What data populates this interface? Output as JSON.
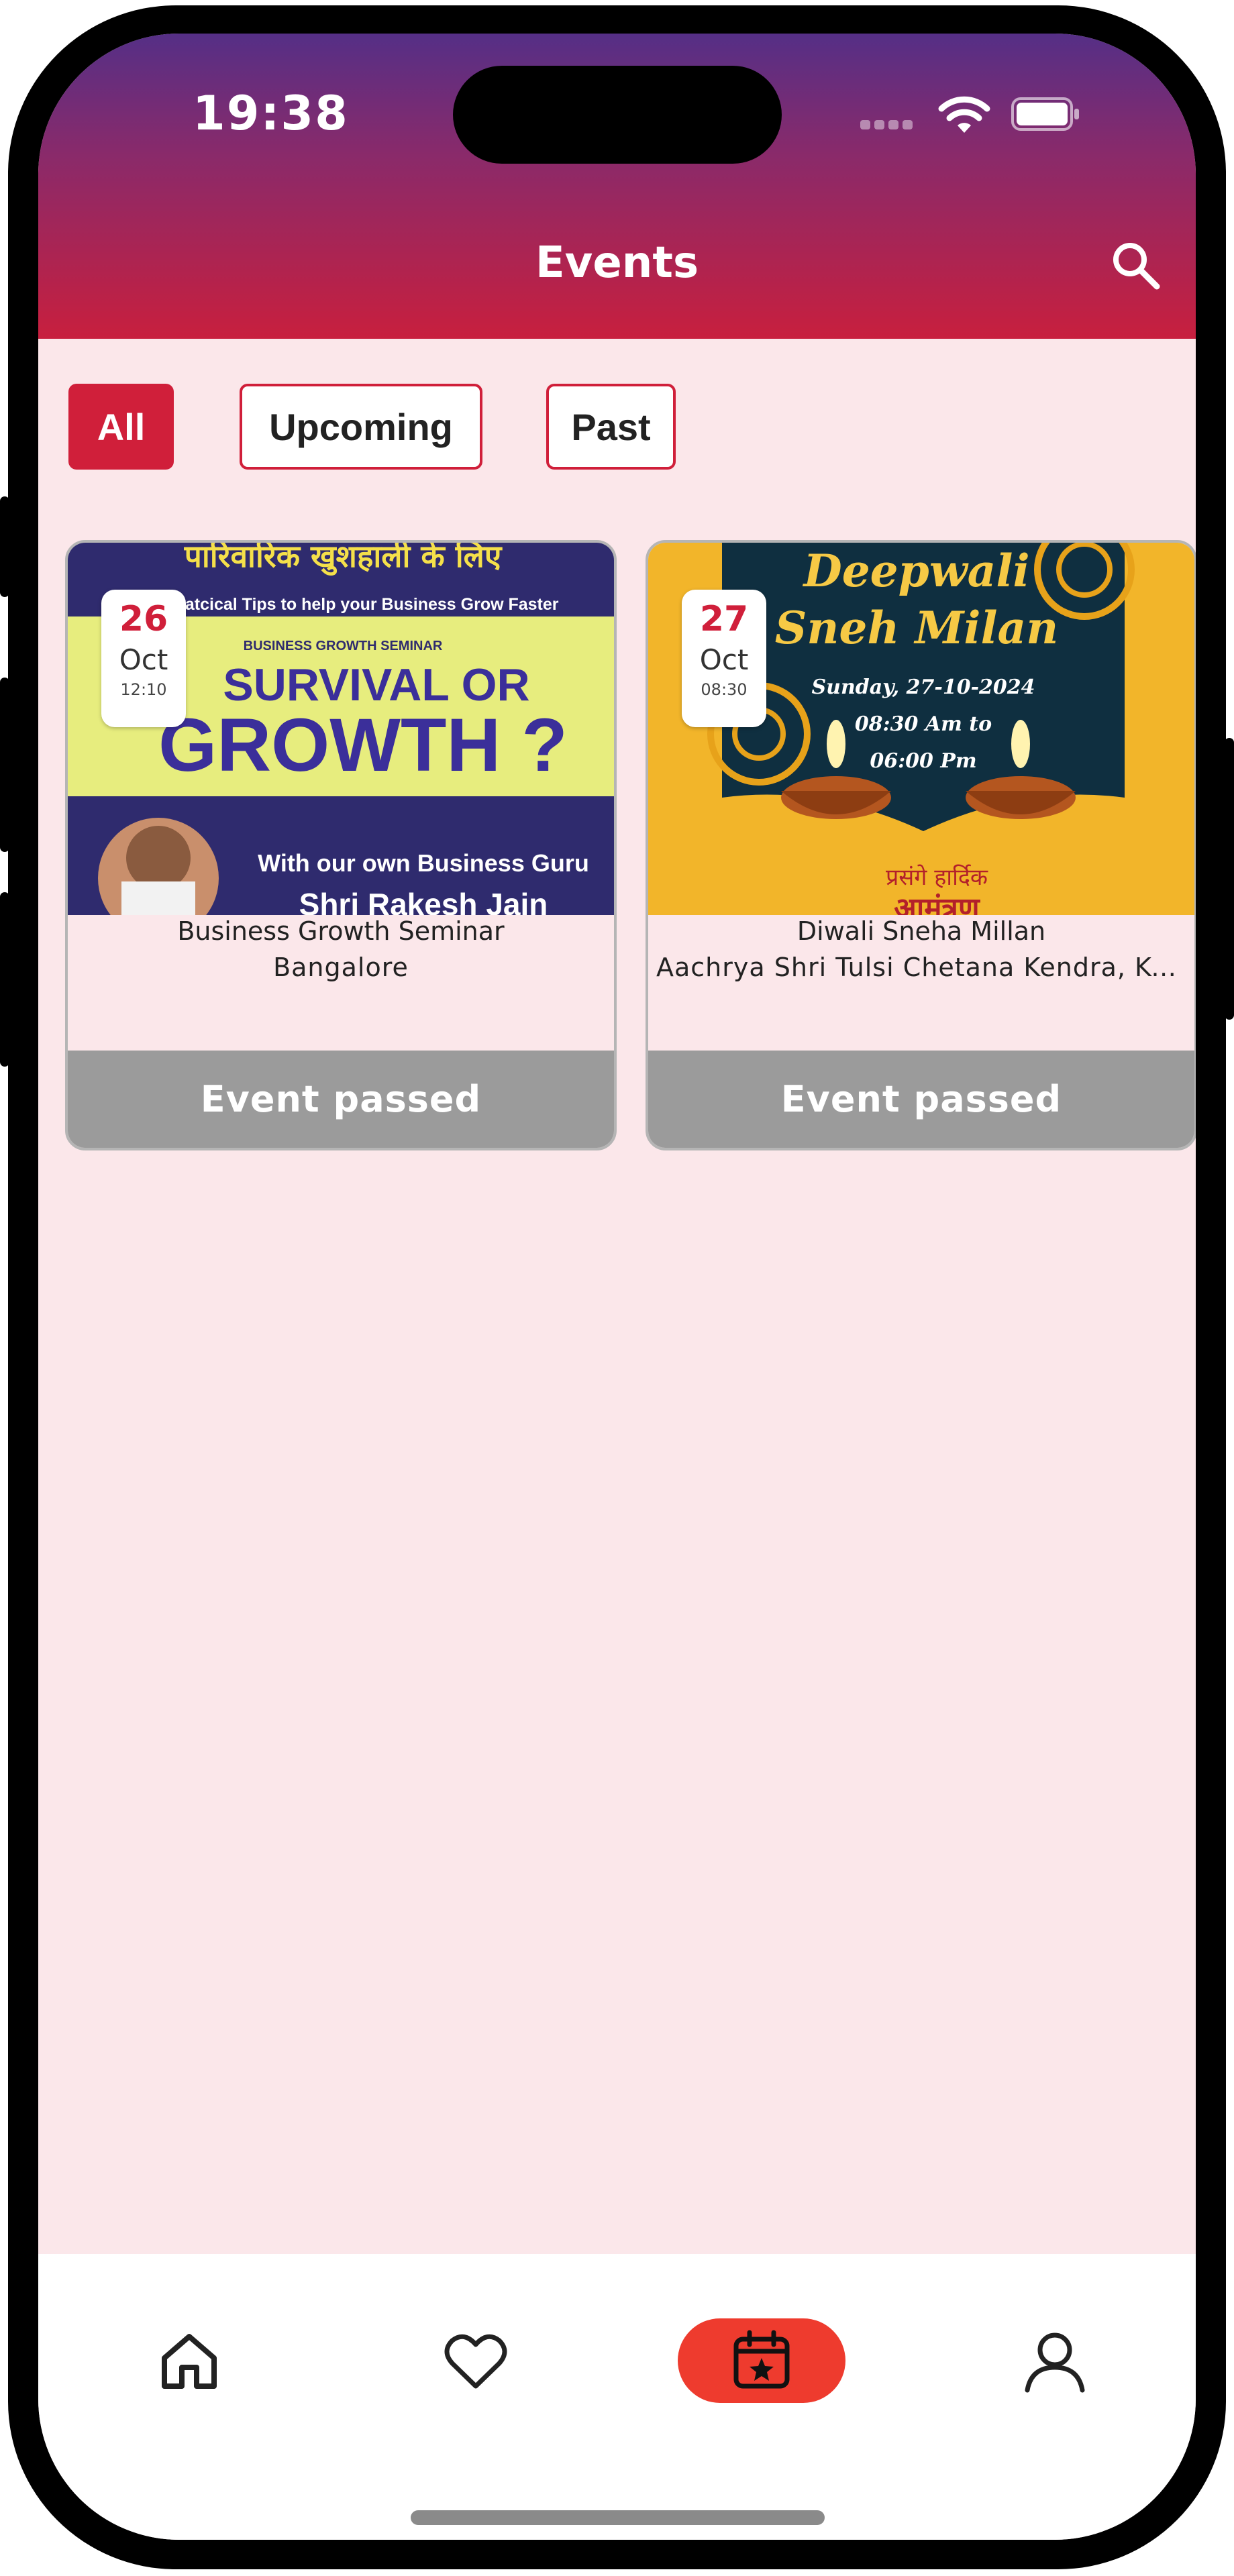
{
  "status_bar": {
    "time": "19:38"
  },
  "header": {
    "title": "Events",
    "search_icon": "search-icon",
    "colors": {
      "top": "#552f86",
      "bottom": "#c81f3e"
    }
  },
  "filters": {
    "selected": "All",
    "options": [
      "All",
      "Upcoming",
      "Past"
    ]
  },
  "events": [
    {
      "day": "26",
      "month": "Oct",
      "time": "12:10",
      "name": "Business Growth Seminar",
      "location": "Bangalore",
      "status": "Event passed",
      "poster": {
        "top_line": "पारिवारिक खुशहाली के लिए",
        "tips": "Pratcical Tips to help your Business Grow Faster",
        "kicker": "BUSINESS GROWTH SEMINAR",
        "headline_1": "SURVIVAL OR",
        "headline_2": "GROWTH ?",
        "guru_line": "With our own Business Guru",
        "guru_name": "Shri Rakesh Jain"
      }
    },
    {
      "day": "27",
      "month": "Oct",
      "time": "08:30",
      "name": "Diwali Sneha Millan",
      "location": "Aachrya Shri Tulsi Chetana Kendra, Ku...",
      "status": "Event passed",
      "poster": {
        "title_1": "Deepwali",
        "title_2": "Sneh Milan",
        "date_line": "Sunday, 27-10-2024",
        "time_line_1": "08:30 Am to",
        "time_line_2": "06:00 Pm",
        "hindi_line": "प्रसंगे हार्दिक",
        "hindi_line_2": "आमंत्रण"
      }
    }
  ],
  "bottom_nav": {
    "items": [
      "home-icon",
      "heart-icon",
      "calendar-star-icon",
      "user-icon"
    ],
    "active": "calendar-star-icon",
    "active_color": "#ee3b2e"
  },
  "colors": {
    "accent": "#d01f3a",
    "background": "#fbe7ea",
    "passed_bar": "#9b9b9b"
  }
}
